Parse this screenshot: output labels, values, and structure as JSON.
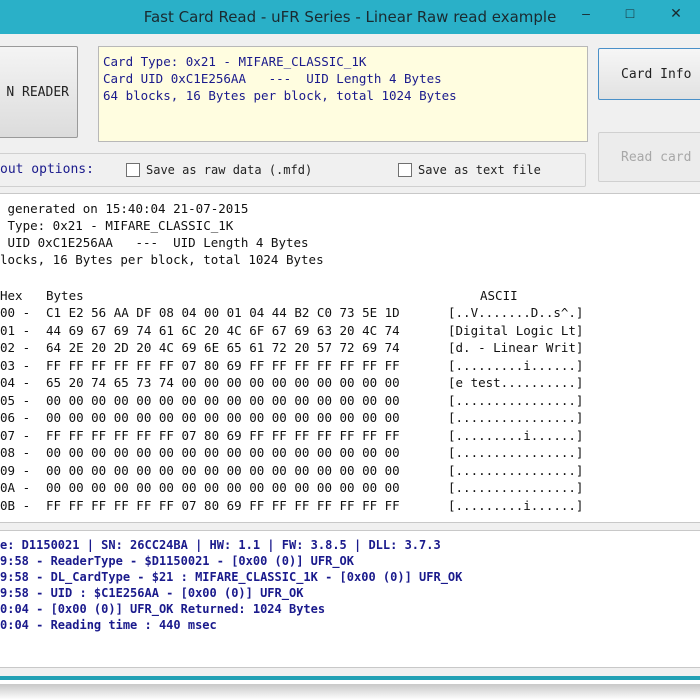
{
  "window": {
    "title": "Fast Card Read - uFR Series - Linear Raw read example",
    "controls": {
      "minimize": "–",
      "maximize": "□",
      "close": "✕"
    }
  },
  "toolbar": {
    "reader_button": "N READER",
    "card_info_button": "Card Info",
    "read_card_button": "Read card"
  },
  "info_box": {
    "lines": [
      "Card Type: 0x21 - MIFARE_CLASSIC_1K",
      "Card UID 0xC1E256AA   ---  UID Length 4 Bytes",
      "64 blocks, 16 Bytes per block, total 1024 Bytes"
    ]
  },
  "options": {
    "label": "out options:",
    "save_raw_label": "Save as raw data (.mfd)",
    "save_text_label": "Save as text file"
  },
  "dump": {
    "intro": [
      " generated on 15:40:04 21-07-2015",
      " Type: 0x21 - MIFARE_CLASSIC_1K",
      " UID 0xC1E256AA   ---  UID Length 4 Bytes",
      "locks, 16 Bytes per block, total 1024 Bytes"
    ],
    "header_hex": "Hex",
    "header_bytes": "Bytes",
    "header_ascii": "ASCII",
    "rows": [
      {
        "addr": "00 -",
        "bytes": "C1 E2 56 AA DF 08 04 00 01 04 44 B2 C0 73 5E 1D",
        "ascii": "[..V.......D..s^.]"
      },
      {
        "addr": "01 -",
        "bytes": "44 69 67 69 74 61 6C 20 4C 6F 67 69 63 20 4C 74",
        "ascii": "[Digital Logic Lt]"
      },
      {
        "addr": "02 -",
        "bytes": "64 2E 20 2D 20 4C 69 6E 65 61 72 20 57 72 69 74",
        "ascii": "[d. - Linear Writ]"
      },
      {
        "addr": "03 -",
        "bytes": "FF FF FF FF FF FF 07 80 69 FF FF FF FF FF FF FF",
        "ascii": "[.........i......]"
      },
      {
        "addr": "04 -",
        "bytes": "65 20 74 65 73 74 00 00 00 00 00 00 00 00 00 00",
        "ascii": "[e test..........]"
      },
      {
        "addr": "05 -",
        "bytes": "00 00 00 00 00 00 00 00 00 00 00 00 00 00 00 00",
        "ascii": "[................]"
      },
      {
        "addr": "06 -",
        "bytes": "00 00 00 00 00 00 00 00 00 00 00 00 00 00 00 00",
        "ascii": "[................]"
      },
      {
        "addr": "07 -",
        "bytes": "FF FF FF FF FF FF 07 80 69 FF FF FF FF FF FF FF",
        "ascii": "[.........i......]"
      },
      {
        "addr": "08 -",
        "bytes": "00 00 00 00 00 00 00 00 00 00 00 00 00 00 00 00",
        "ascii": "[................]"
      },
      {
        "addr": "09 -",
        "bytes": "00 00 00 00 00 00 00 00 00 00 00 00 00 00 00 00",
        "ascii": "[................]"
      },
      {
        "addr": "0A -",
        "bytes": "00 00 00 00 00 00 00 00 00 00 00 00 00 00 00 00",
        "ascii": "[................]"
      },
      {
        "addr": "0B -",
        "bytes": "FF FF FF FF FF FF 07 80 69 FF FF FF FF FF FF FF",
        "ascii": "[.........i......]"
      }
    ]
  },
  "log": {
    "lines": [
      "e: D1150021 | SN: 26CC24BA | HW: 1.1 | FW: 3.8.5 | DLL: 3.7.3",
      "9:58 - ReaderType - $D1150021 - [0x00 (0)] UFR_OK",
      "9:58 - DL_CardType - $21 : MIFARE_CLASSIC_1K - [0x00 (0)] UFR_OK",
      "9:58 - UID : $C1E256AA - [0x00 (0)] UFR_OK",
      "0:04 - [0x00 (0)] UFR_OK Returned: 1024 Bytes",
      "0:04 - Reading time : 440 msec"
    ]
  }
}
